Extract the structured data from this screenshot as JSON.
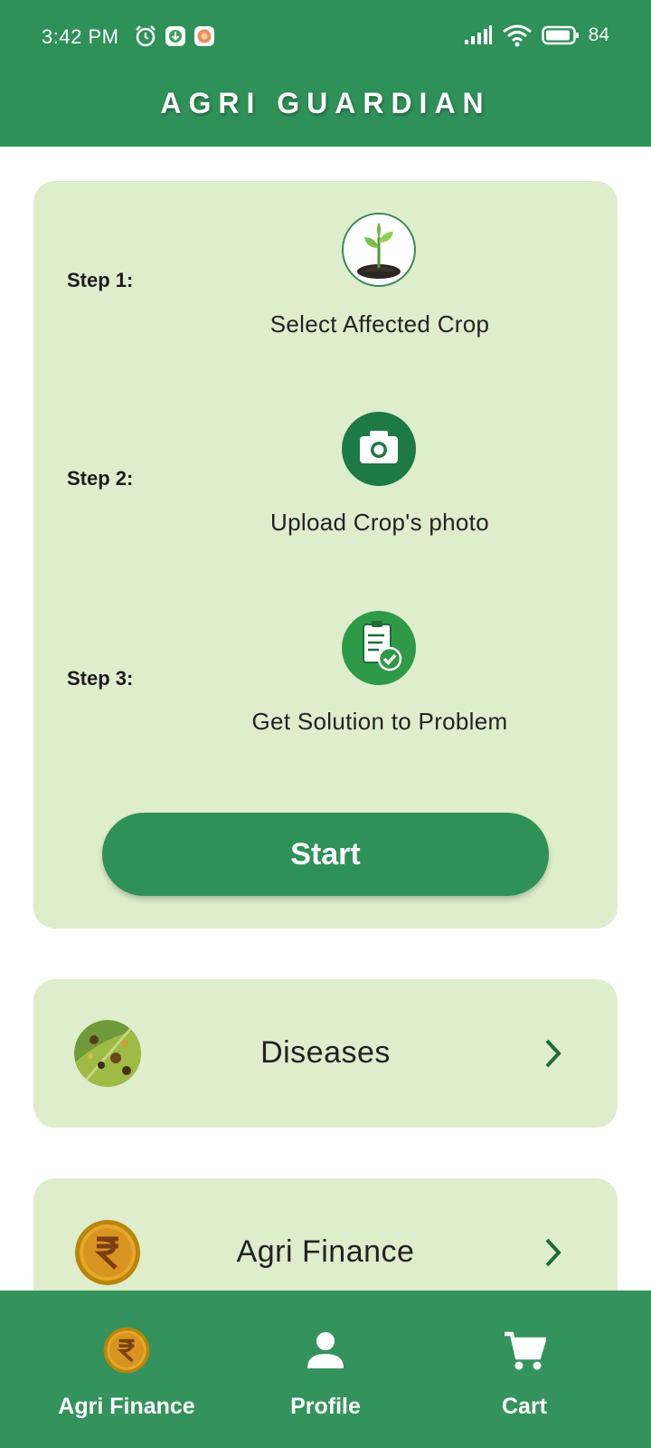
{
  "status_bar": {
    "time": "3:42 PM",
    "battery": "84",
    "left_icons": [
      "alarm-icon",
      "download-icon",
      "app-notification-icon"
    ],
    "right_icons": [
      "signal-icon",
      "wifi-icon",
      "battery-icon"
    ]
  },
  "app": {
    "title": "AGRI GUARDIAN",
    "accent_color": "#2e9158",
    "card_color": "#deedcc"
  },
  "steps": [
    {
      "label": "Step 1:",
      "text": "Select Affected Crop",
      "icon": "seedling-icon"
    },
    {
      "label": "Step 2:",
      "text": "Upload Crop's photo",
      "icon": "camera-icon"
    },
    {
      "label": "Step 3:",
      "text": "Get Solution to Problem",
      "icon": "checklist-icon"
    }
  ],
  "start_button": {
    "label": "Start"
  },
  "menu": [
    {
      "label": "Diseases",
      "icon": "leaf-disease-thumbnail"
    },
    {
      "label": "Agri Finance",
      "icon": "rupee-coin-icon"
    }
  ],
  "bottom_nav": [
    {
      "label": "Agri Finance",
      "icon": "rupee-coin-icon"
    },
    {
      "label": "Profile",
      "icon": "person-icon"
    },
    {
      "label": "Cart",
      "icon": "cart-icon"
    }
  ]
}
